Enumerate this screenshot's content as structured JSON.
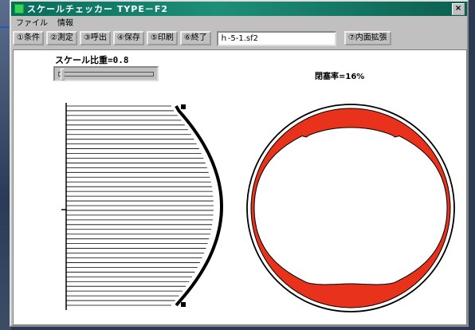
{
  "window": {
    "title": "スケールチェッカー TYPE－F2",
    "close_glyph": "×"
  },
  "menu": [
    "ファイル",
    "情報"
  ],
  "toolbar": {
    "buttons": [
      "①条件",
      "②測定",
      "③呼出",
      "④保存",
      "⑤印刷",
      "⑥終了"
    ],
    "file_value": "ｈ-5-1.sf2",
    "right_button": "⑦内面拡張"
  },
  "canvas": {
    "scale_label": "スケール比重=0.8",
    "scale_slider_level": 0.02,
    "blockage_label": "閉塞率=16%"
  },
  "colors": {
    "deposit": "#e8321c",
    "title_bar": "#0a6b5a",
    "window_face": "#c0c0c0"
  },
  "icons": [
    "app-icon",
    "close-icon"
  ]
}
